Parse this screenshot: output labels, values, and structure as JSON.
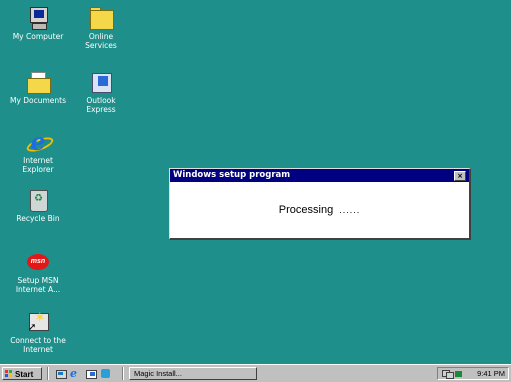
{
  "desktop": {
    "icons": [
      {
        "label": "My Computer"
      },
      {
        "label": "Online\nServices"
      },
      {
        "label": "My Documents"
      },
      {
        "label": "Outlook\nExpress"
      },
      {
        "label": "Internet\nExplorer"
      },
      {
        "label": "Recycle Bin"
      },
      {
        "label": "Setup MSN\nInternet A..."
      },
      {
        "label": "Connect to the\nInternet"
      }
    ],
    "msn_logo_text": "msn"
  },
  "dialog": {
    "title": "Windows setup program",
    "close_label": "×",
    "message": "Processing",
    "dots": "......"
  },
  "taskbar": {
    "start_label": "Start",
    "task_button_label": "Magic Install...",
    "clock": "9:41 PM"
  },
  "colors": {
    "desktop": "#1e8f8a",
    "titlebar": "#000080",
    "taskbar": "#c0c0c0"
  }
}
